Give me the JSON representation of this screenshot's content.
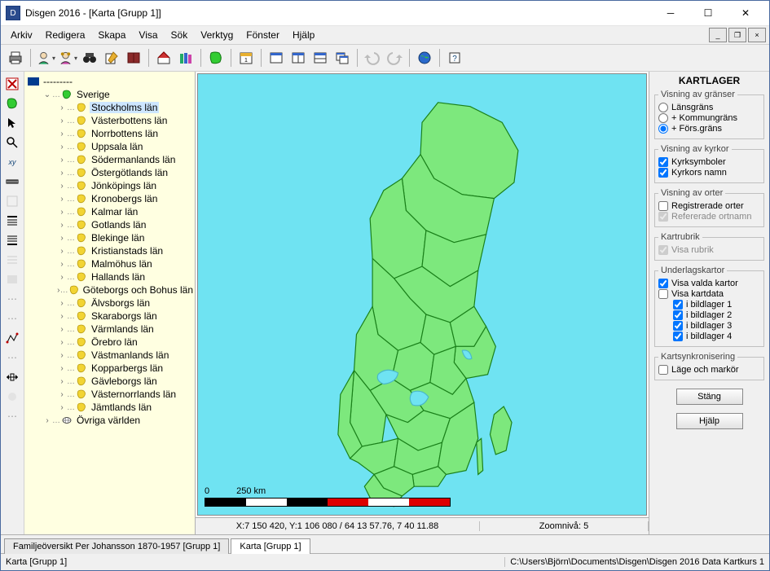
{
  "title": "Disgen 2016 - [Karta [Grupp 1]]",
  "menus": [
    "Arkiv",
    "Redigera",
    "Skapa",
    "Visa",
    "Sök",
    "Verktyg",
    "Fönster",
    "Hjälp"
  ],
  "tree": {
    "root_dashes": "---------",
    "country": "Sverige",
    "selected": "Stockholms län",
    "counties": [
      "Stockholms län",
      "Västerbottens län",
      "Norrbottens län",
      "Uppsala län",
      "Södermanlands län",
      "Östergötlands län",
      "Jönköpings län",
      "Kronobergs län",
      "Kalmar län",
      "Gotlands län",
      "Blekinge län",
      "Kristianstads län",
      "Malmöhus län",
      "Hallands län",
      "Göteborgs och Bohus län",
      "Älvsborgs län",
      "Skaraborgs län",
      "Värmlands län",
      "Örebro län",
      "Västmanlands län",
      "Kopparbergs län",
      "Gävleborgs län",
      "Västernorrlands län",
      "Jämtlands län"
    ],
    "other": "Övriga världen"
  },
  "side": {
    "header": "KARTLAGER",
    "borders_legend": "Visning av gränser",
    "borders": {
      "lans": "Länsgräns",
      "kommun": "+ Kommungräns",
      "fors": "+ Förs.gräns"
    },
    "churches_legend": "Visning av kyrkor",
    "churches": {
      "sym": "Kyrksymboler",
      "name": "Kyrkors namn"
    },
    "places_legend": "Visning av orter",
    "places": {
      "reg": "Registrerade orter",
      "ref": "Refererade ortnamn"
    },
    "rubrik_legend": "Kartrubrik",
    "rubrik": {
      "show": "Visa rubrik"
    },
    "under_legend": "Underlagskartor",
    "under": {
      "valda": "Visa valda kartor",
      "data": "Visa kartdata",
      "l1": "i bildlager  1",
      "l2": "i bildlager  2",
      "l3": "i bildlager  3",
      "l4": "i bildlager  4"
    },
    "sync_legend": "Kartsynkronisering",
    "sync": {
      "pos": "Läge och markör"
    },
    "close": "Stäng",
    "help": "Hjälp"
  },
  "scale": {
    "zero": "0",
    "dist": "250 km"
  },
  "map_status": {
    "coord": "X:7 150 420, Y:1 106 080 / 64 13 57.76, 7 40 11.88",
    "zoom": "Zoomnivå: 5"
  },
  "tabs": {
    "t1": "Familjeöversikt Per Johansson 1870-1957 [Grupp 1]",
    "t2": "Karta [Grupp 1]"
  },
  "status": {
    "left": "Karta [Grupp 1]",
    "right": "C:\\Users\\Björn\\Documents\\Disgen\\Disgen 2016 Data Kartkurs 1"
  }
}
